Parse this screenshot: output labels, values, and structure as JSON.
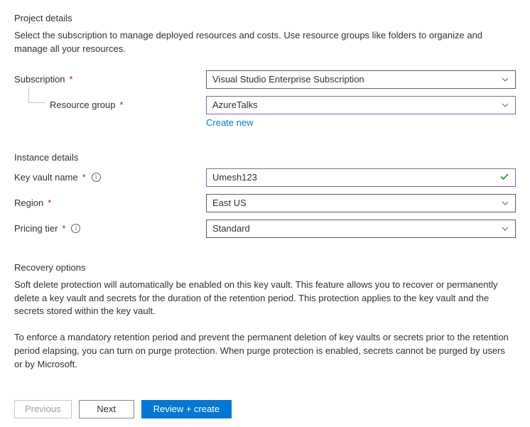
{
  "project_details": {
    "title": "Project details",
    "description": "Select the subscription to manage deployed resources and costs. Use resource groups like folders to organize and manage all your resources.",
    "subscription_label": "Subscription",
    "subscription_value": "Visual Studio Enterprise Subscription",
    "resource_group_label": "Resource group",
    "resource_group_value": "AzureTalks",
    "create_new_link": "Create new"
  },
  "instance_details": {
    "title": "Instance details",
    "keyvault_label": "Key vault name",
    "keyvault_value": "Umesh123",
    "region_label": "Region",
    "region_value": "East US",
    "pricing_label": "Pricing tier",
    "pricing_value": "Standard"
  },
  "recovery_options": {
    "title": "Recovery options",
    "paragraph1": "Soft delete protection will automatically be enabled on this key vault. This feature allows you to recover or permanently delete a key vault and secrets for the duration of the retention period. This protection applies to the key vault and the secrets stored within the key vault.",
    "paragraph2": "To enforce a mandatory retention period and prevent the permanent deletion of key vaults or secrets prior to the retention period elapsing, you can turn on purge protection. When purge protection is enabled, secrets cannot be purged by users or by Microsoft."
  },
  "footer": {
    "previous": "Previous",
    "next": "Next",
    "review": "Review + create"
  }
}
